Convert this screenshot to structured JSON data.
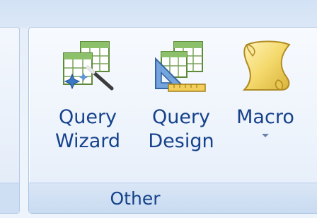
{
  "ribbon": {
    "group": {
      "label": "Other",
      "buttons": [
        {
          "line1": "Query",
          "line2": "Wizard",
          "icon": "query-wizard-icon"
        },
        {
          "line1": "Query",
          "line2": "Design",
          "icon": "query-design-icon"
        },
        {
          "line1": "Macro",
          "icon": "macro-scroll-icon",
          "has_dropdown": true
        }
      ]
    }
  }
}
